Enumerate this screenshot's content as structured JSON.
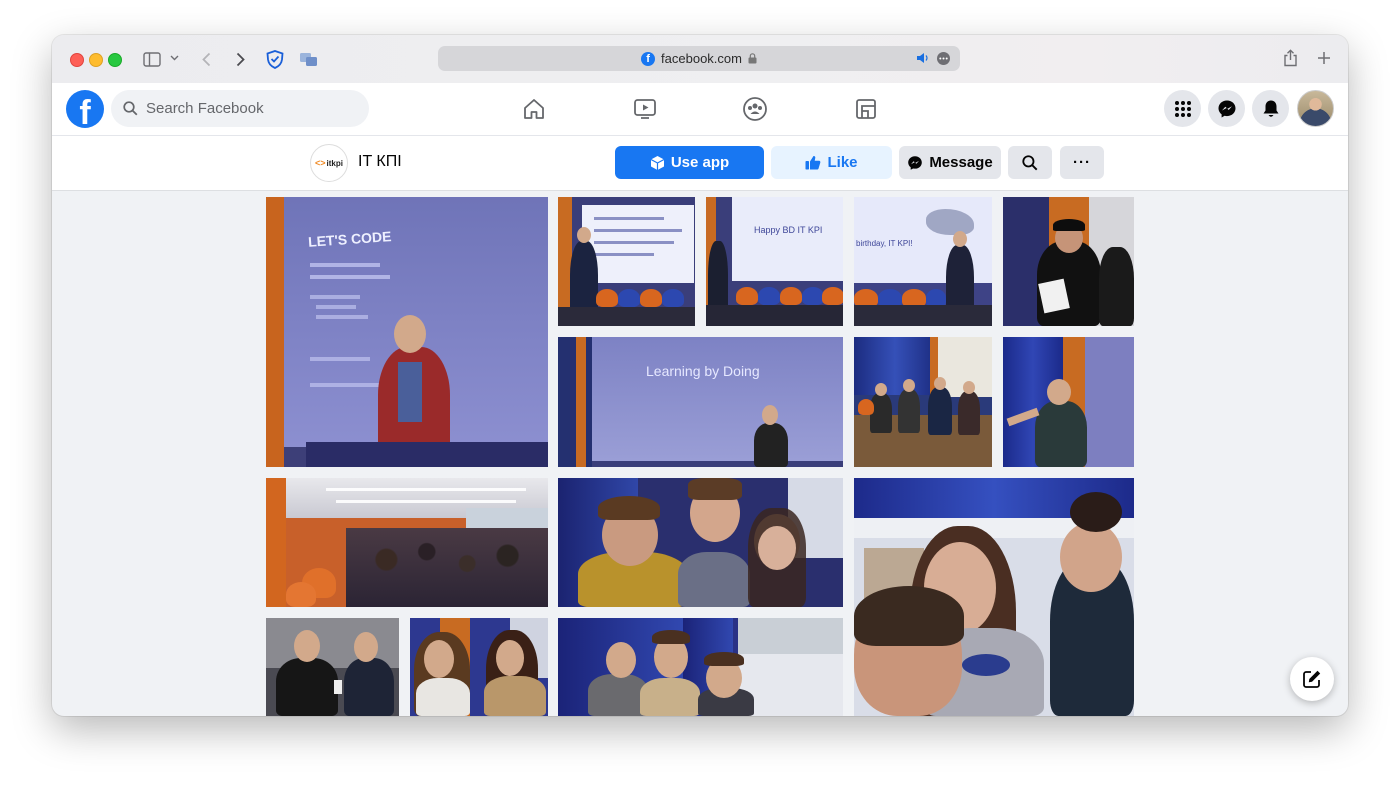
{
  "browser": {
    "url": "facebook.com"
  },
  "nav": {
    "search_placeholder": "Search Facebook"
  },
  "page": {
    "name": "IT КПІ",
    "avatar_text": "itkpi",
    "buttons": {
      "use_app": "Use app",
      "like": "Like",
      "message": "Message",
      "more": "···"
    }
  },
  "photos": {
    "slide_lets_code": "LET'S CODE",
    "slide_happy_bd": "Happy BD IT KPI",
    "slide_birthday": "birthday, IT KPI!",
    "slide_learning": "Learning by Doing"
  },
  "colors": {
    "fb_blue": "#1877f2",
    "like_bg": "#e7f3ff",
    "page_bg": "#f0f2f5"
  }
}
